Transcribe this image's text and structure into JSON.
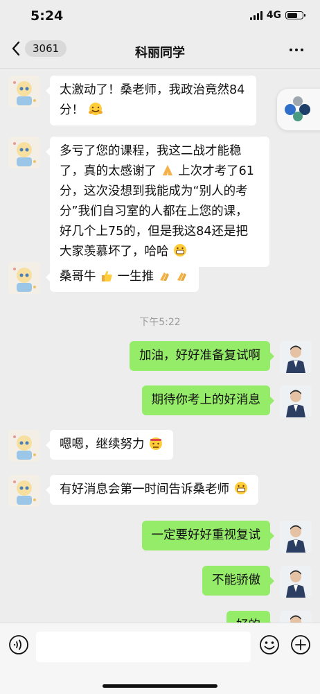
{
  "status_bar": {
    "time": "5:24",
    "network": "4G"
  },
  "nav": {
    "unread_count": "3061",
    "title": "科丽同学"
  },
  "messages": [
    {
      "side": "left",
      "pre": "太激动了！桑老师，我政治竟然84分！",
      "emoji": "hugging-face"
    },
    {
      "side": "left",
      "pre": "多亏了您的课程，我这二战才能稳了，真的太感谢了",
      "emoji": "folded-hands",
      "post": "上次才考了61分，这次没想到我能成为“别人的考分”我们自习室的人都在上您的课，好几个上75的，但是我这84还是把大家羡慕坏了，哈哈",
      "emoji2": "grinning-face"
    },
    {
      "side": "left",
      "pre": "桑哥牛",
      "emoji": "thumbs-up",
      "post": "一生推",
      "emoji2": "clapping-hands"
    },
    {
      "side": "right",
      "text": "加油，好好准备复试啊"
    },
    {
      "side": "right",
      "text": "期待你考上的好消息"
    },
    {
      "side": "left",
      "pre": "嗯嗯，继续努力",
      "emoji": "determined-face"
    },
    {
      "side": "left",
      "pre": "有好消息会第一时间告诉桑老师",
      "emoji": "grinning-face"
    },
    {
      "side": "right",
      "text": "一定要好好重视复试"
    },
    {
      "side": "right",
      "text": "不能骄傲"
    },
    {
      "side": "right",
      "text": "好的"
    }
  ],
  "timestamp": "下午5:22",
  "colors": {
    "background": "#ededed",
    "sent_bubble": "#95ec69",
    "received_bubble": "#ffffff"
  },
  "icons": [
    "back-chevron-icon",
    "more-icon",
    "voice-icon",
    "emoji-icon",
    "add-icon",
    "mini-program-float-icon"
  ]
}
